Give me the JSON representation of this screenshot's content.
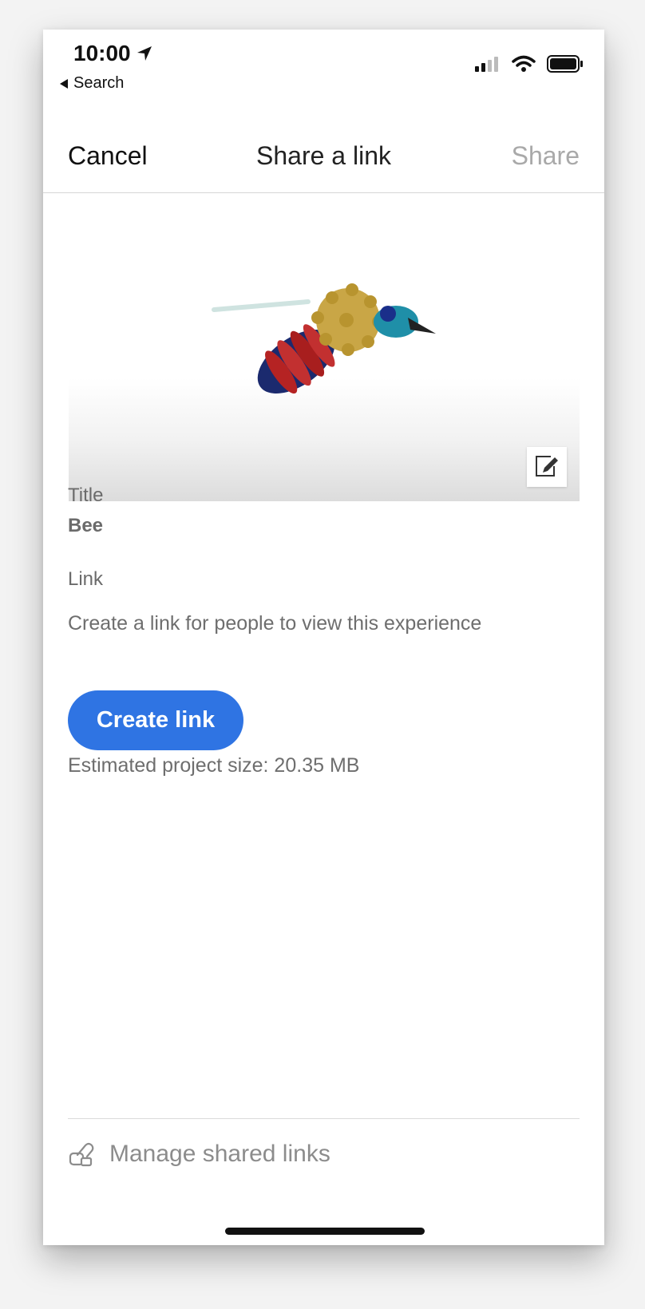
{
  "status_bar": {
    "time": "10:00",
    "back_label": "Search"
  },
  "nav": {
    "cancel": "Cancel",
    "title": "Share a link",
    "share": "Share"
  },
  "preview": {
    "subject": "bee-3d-model"
  },
  "form": {
    "title_label": "Title",
    "title_value": "Bee",
    "link_label": "Link",
    "link_description": "Create a link for people to view this experience",
    "create_button": "Create link",
    "size_text": "Estimated project size: 20.35 MB"
  },
  "footer": {
    "manage_label": "Manage shared links"
  },
  "colors": {
    "accent": "#2f74e3",
    "disabled": "#a9a9a9"
  }
}
